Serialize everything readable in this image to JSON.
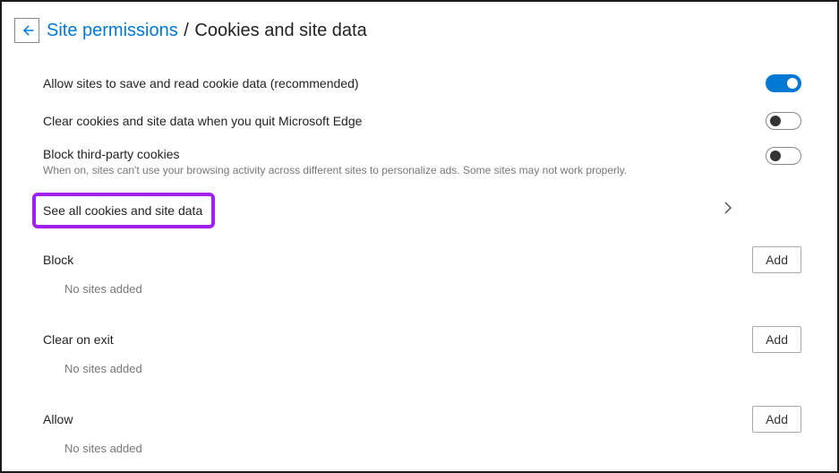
{
  "header": {
    "breadcrumb_link": "Site permissions",
    "breadcrumb_separator": " / ",
    "breadcrumb_current": "Cookies and site data"
  },
  "settings": {
    "allow_cookies": {
      "title": "Allow sites to save and read cookie data (recommended)",
      "on": true
    },
    "clear_on_quit": {
      "title": "Clear cookies and site data when you quit Microsoft Edge",
      "on": false
    },
    "block_third_party": {
      "title": "Block third-party cookies",
      "desc": "When on, sites can't use your browsing activity across different sites to personalize ads. Some sites may not work properly.",
      "on": false
    },
    "see_all": {
      "title": "See all cookies and site data"
    }
  },
  "sections": {
    "block": {
      "title": "Block",
      "add_label": "Add",
      "empty": "No sites added"
    },
    "clear_on_exit": {
      "title": "Clear on exit",
      "add_label": "Add",
      "empty": "No sites added"
    },
    "allow": {
      "title": "Allow",
      "add_label": "Add",
      "empty": "No sites added"
    }
  }
}
